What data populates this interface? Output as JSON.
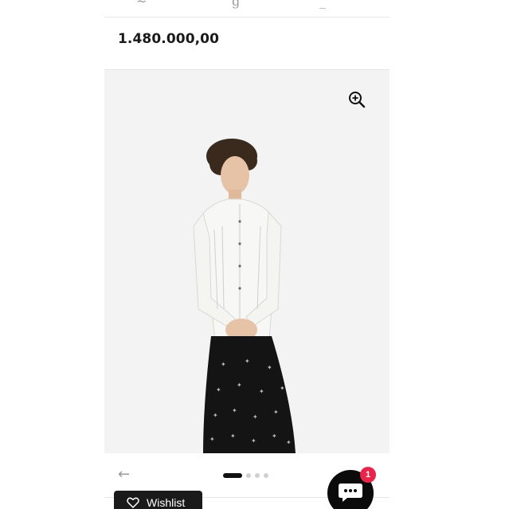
{
  "product": {
    "price": "1.480.000,00"
  },
  "gallery": {
    "prev_arrow": "←",
    "dot_count": 4,
    "active_index": 0
  },
  "wishlist": {
    "label": "Wishlist"
  },
  "chat": {
    "unread_count": "1"
  },
  "icons": {
    "zoom": "zoom-in-icon",
    "heart": "heart-icon",
    "chat": "chat-bubble-icon"
  },
  "colors": {
    "badge": "#e8244a",
    "button_dark": "#1a1a1a",
    "image_bg": "#f3f3f3"
  }
}
